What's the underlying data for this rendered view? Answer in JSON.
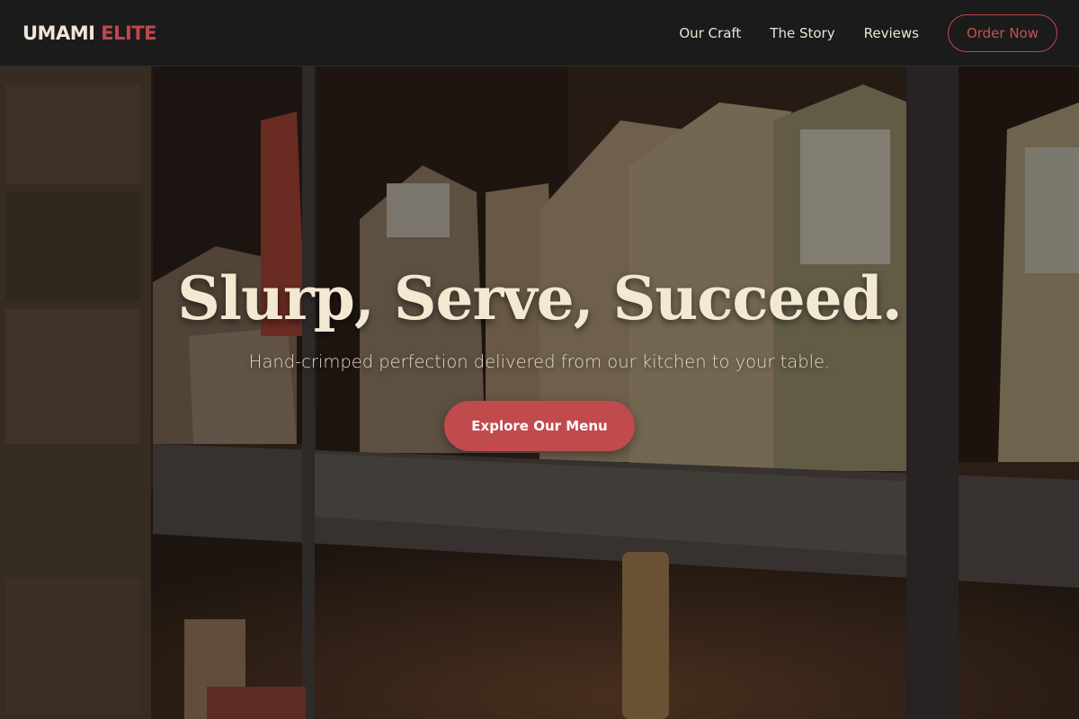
{
  "brand": {
    "name_part1": "UMAMI",
    "name_part2": "ELITE"
  },
  "nav": {
    "links": [
      "Our Craft",
      "The Story",
      "Reviews"
    ],
    "order_label": "Order Now"
  },
  "hero": {
    "title": "Slurp, Serve, Succeed.",
    "subtitle": "Hand-crimped perfection delivered from our kitchen to your table.",
    "cta_label": "Explore Our Menu"
  },
  "colors": {
    "accent": "#c14a4d",
    "header_bg": "#1b1b1b",
    "title_text": "#f3e8d2"
  }
}
